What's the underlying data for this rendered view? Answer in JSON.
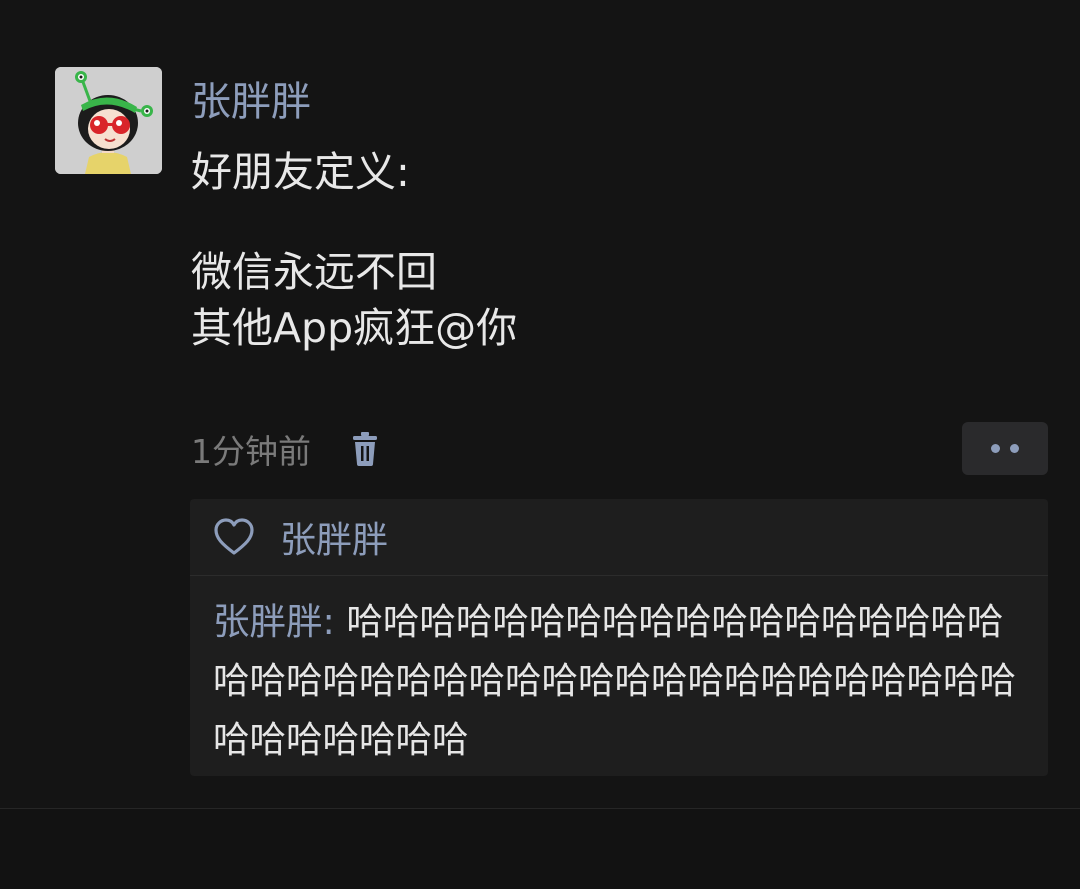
{
  "post": {
    "author": "张胖胖",
    "content": {
      "line1": "好朋友定义:",
      "line2": "微信永远不回",
      "line3": "其他App疯狂@你"
    },
    "time": "1分钟前",
    "icons": {
      "delete": "trash-icon",
      "more": "more-dots-icon",
      "like": "heart-icon"
    }
  },
  "likes": {
    "names": "张胖胖"
  },
  "comments": [
    {
      "author": "张胖胖",
      "separator": ": ",
      "text": "哈哈哈哈哈哈哈哈哈哈哈哈哈哈哈哈哈哈哈哈哈哈哈哈哈哈哈哈哈哈哈哈哈哈哈哈哈哈哈哈哈哈哈哈哈哈哈"
    }
  ],
  "colors": {
    "background": "#141414",
    "name_blue": "#8d9dbb",
    "text": "#e8e8e8",
    "muted": "#7a7a7a",
    "panel": "#1e1e1e"
  }
}
